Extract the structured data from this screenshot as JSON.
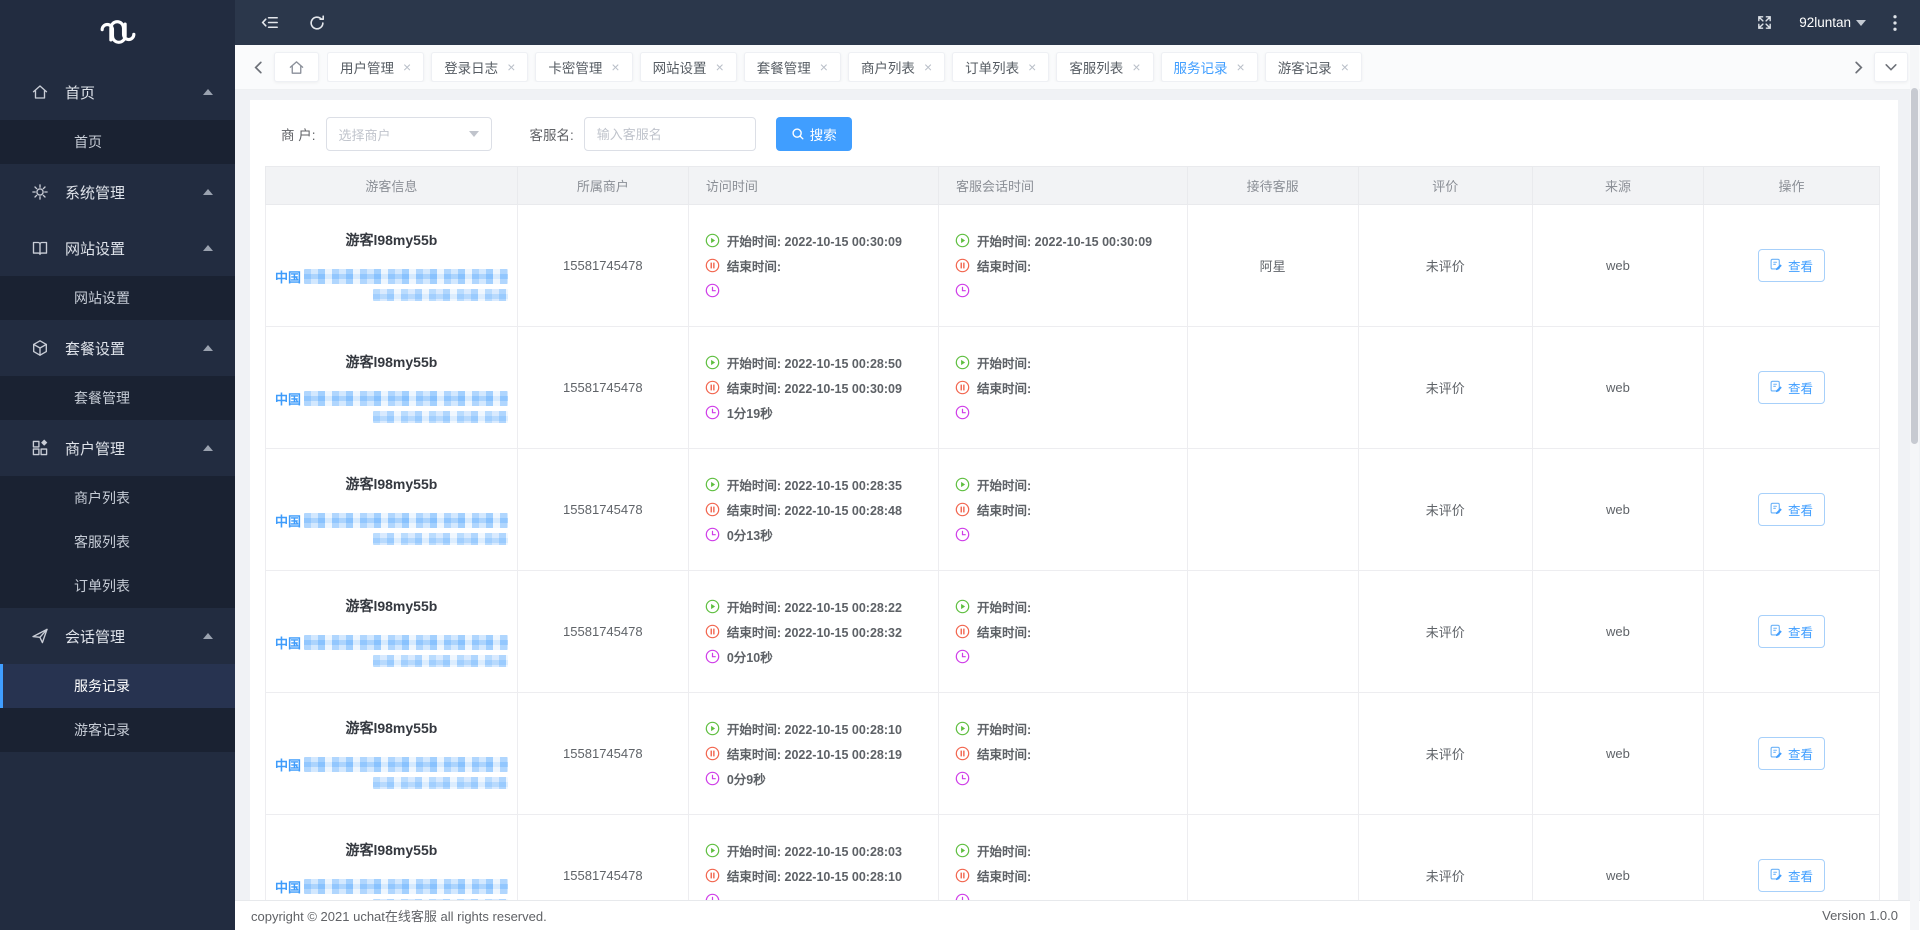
{
  "topbar": {
    "username": "92luntan"
  },
  "icons": {
    "close": "×"
  },
  "sidebar": {
    "groups": [
      {
        "name": "home",
        "icon": "home-icon",
        "label": "首页",
        "children": [
          {
            "name": "home",
            "label": "首页",
            "active": false
          }
        ]
      },
      {
        "name": "system-management",
        "icon": "gear-icon",
        "label": "系统管理",
        "children": []
      },
      {
        "name": "website-settings",
        "icon": "book-icon",
        "label": "网站设置",
        "children": [
          {
            "name": "website-settings",
            "label": "网站设置",
            "active": false
          }
        ]
      },
      {
        "name": "package-settings",
        "icon": "cube-icon",
        "label": "套餐设置",
        "children": [
          {
            "name": "package-management",
            "label": "套餐管理",
            "active": false
          }
        ]
      },
      {
        "name": "merchant-management",
        "icon": "grid-icon",
        "label": "商户管理",
        "children": [
          {
            "name": "merchant-list",
            "label": "商户列表",
            "active": false
          },
          {
            "name": "agent-list",
            "label": "客服列表",
            "active": false
          },
          {
            "name": "order-list",
            "label": "订单列表",
            "active": false
          }
        ]
      },
      {
        "name": "session-management",
        "icon": "send-icon",
        "label": "会话管理",
        "children": [
          {
            "name": "service-records",
            "label": "服务记录",
            "active": true
          },
          {
            "name": "visitor-records",
            "label": "游客记录",
            "active": false
          }
        ]
      }
    ]
  },
  "tabbar": {
    "tabs": [
      {
        "name": "user-management",
        "label": "用户管理",
        "active": false
      },
      {
        "name": "login-logs",
        "label": "登录日志",
        "active": false
      },
      {
        "name": "card-key-management",
        "label": "卡密管理",
        "active": false
      },
      {
        "name": "website-settings",
        "label": "网站设置",
        "active": false
      },
      {
        "name": "package-management",
        "label": "套餐管理",
        "active": false
      },
      {
        "name": "merchant-list",
        "label": "商户列表",
        "active": false
      },
      {
        "name": "order-list",
        "label": "订单列表",
        "active": false
      },
      {
        "name": "agent-list",
        "label": "客服列表",
        "active": false
      },
      {
        "name": "service-records",
        "label": "服务记录",
        "active": true
      },
      {
        "name": "visitor-records",
        "label": "游客记录",
        "active": false
      }
    ]
  },
  "filter": {
    "merchant_label": "商 户:",
    "merchant_placeholder": "选择商户",
    "agent_label": "客服名:",
    "agent_placeholder": "输入客服名",
    "search_label": "搜索"
  },
  "table": {
    "headers": [
      "游客信息",
      "所属商户",
      "访问时间",
      "客服会话时间",
      "接待客服",
      "评价",
      "来源",
      "操作"
    ],
    "time_labels": {
      "start": "开始时间:",
      "end": "结束时间:"
    },
    "rows": [
      {
        "visitor": {
          "name": "游客l98my55b",
          "location": "中国"
        },
        "merchant": "15581745478",
        "visit": {
          "start": "2022-10-15 00:30:09",
          "end": "",
          "duration": ""
        },
        "session": {
          "start": "2022-10-15 00:30:09",
          "end": "",
          "duration": ""
        },
        "agent": "阿星",
        "rating": "未评价",
        "source": "web",
        "action": "查看"
      },
      {
        "visitor": {
          "name": "游客l98my55b",
          "location": "中国"
        },
        "merchant": "15581745478",
        "visit": {
          "start": "2022-10-15 00:28:50",
          "end": "2022-10-15 00:30:09",
          "duration": "1分19秒"
        },
        "session": {
          "start": "",
          "end": "",
          "duration": ""
        },
        "agent": "",
        "rating": "未评价",
        "source": "web",
        "action": "查看"
      },
      {
        "visitor": {
          "name": "游客l98my55b",
          "location": "中国"
        },
        "merchant": "15581745478",
        "visit": {
          "start": "2022-10-15 00:28:35",
          "end": "2022-10-15 00:28:48",
          "duration": "0分13秒"
        },
        "session": {
          "start": "",
          "end": "",
          "duration": ""
        },
        "agent": "",
        "rating": "未评价",
        "source": "web",
        "action": "查看"
      },
      {
        "visitor": {
          "name": "游客l98my55b",
          "location": "中国"
        },
        "merchant": "15581745478",
        "visit": {
          "start": "2022-10-15 00:28:22",
          "end": "2022-10-15 00:28:32",
          "duration": "0分10秒"
        },
        "session": {
          "start": "",
          "end": "",
          "duration": ""
        },
        "agent": "",
        "rating": "未评价",
        "source": "web",
        "action": "查看"
      },
      {
        "visitor": {
          "name": "游客l98my55b",
          "location": "中国"
        },
        "merchant": "15581745478",
        "visit": {
          "start": "2022-10-15 00:28:10",
          "end": "2022-10-15 00:28:19",
          "duration": "0分9秒"
        },
        "session": {
          "start": "",
          "end": "",
          "duration": ""
        },
        "agent": "",
        "rating": "未评价",
        "source": "web",
        "action": "查看"
      },
      {
        "visitor": {
          "name": "游客l98my55b",
          "location": "中国"
        },
        "merchant": "15581745478",
        "visit": {
          "start": "2022-10-15 00:28:03",
          "end": "2022-10-15 00:28:10",
          "duration": ""
        },
        "session": {
          "start": "",
          "end": "",
          "duration": ""
        },
        "agent": "",
        "rating": "未评价",
        "source": "web",
        "action": "查看"
      }
    ]
  },
  "footer": {
    "copyright": "copyright © 2021 uchat在线客服 all rights reserved.",
    "version": "Version 1.0.0"
  }
}
